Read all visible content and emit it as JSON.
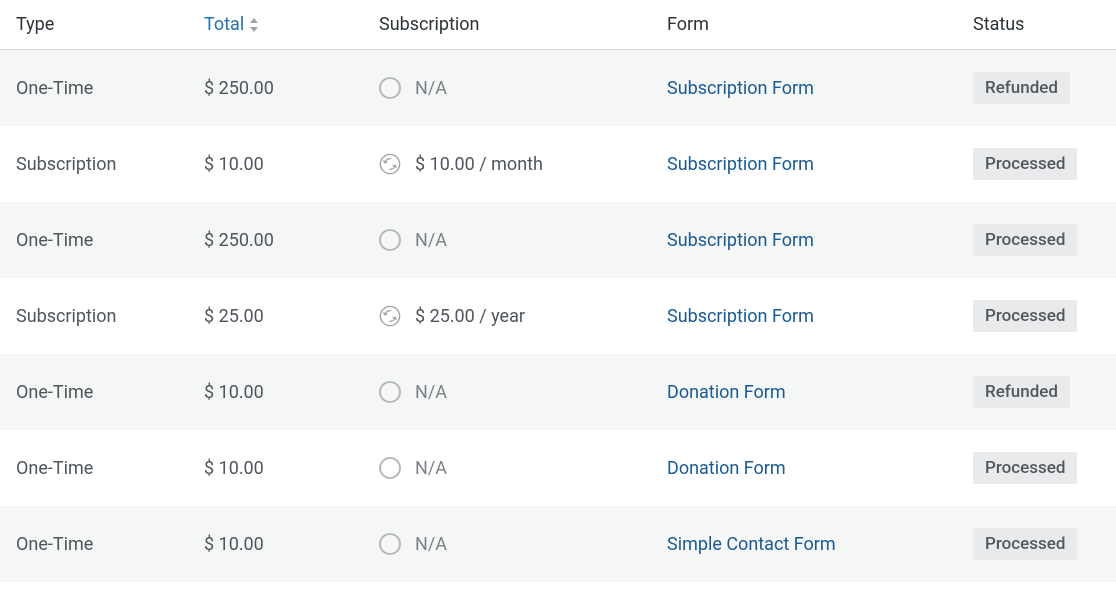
{
  "columns": {
    "type": "Type",
    "total": "Total",
    "subscription": "Subscription",
    "form": "Form",
    "status": "Status"
  },
  "rows": [
    {
      "type": "One-Time",
      "total": "$ 250.00",
      "sub_icon": "circle",
      "sub_text": "N/A",
      "form": "Subscription Form",
      "status": "Refunded"
    },
    {
      "type": "Subscription",
      "total": "$ 10.00",
      "sub_icon": "recur",
      "sub_text": "$ 10.00 / month",
      "form": "Subscription Form",
      "status": "Processed"
    },
    {
      "type": "One-Time",
      "total": "$ 250.00",
      "sub_icon": "circle",
      "sub_text": "N/A",
      "form": "Subscription Form",
      "status": "Processed"
    },
    {
      "type": "Subscription",
      "total": "$ 25.00",
      "sub_icon": "recur",
      "sub_text": "$ 25.00 / year",
      "form": "Subscription Form",
      "status": "Processed"
    },
    {
      "type": "One-Time",
      "total": "$ 10.00",
      "sub_icon": "circle",
      "sub_text": "N/A",
      "form": "Donation Form",
      "status": "Refunded"
    },
    {
      "type": "One-Time",
      "total": "$ 10.00",
      "sub_icon": "circle",
      "sub_text": "N/A",
      "form": "Donation Form",
      "status": "Processed"
    },
    {
      "type": "One-Time",
      "total": "$ 10.00",
      "sub_icon": "circle",
      "sub_text": "N/A",
      "form": "Simple Contact Form",
      "status": "Processed"
    }
  ]
}
